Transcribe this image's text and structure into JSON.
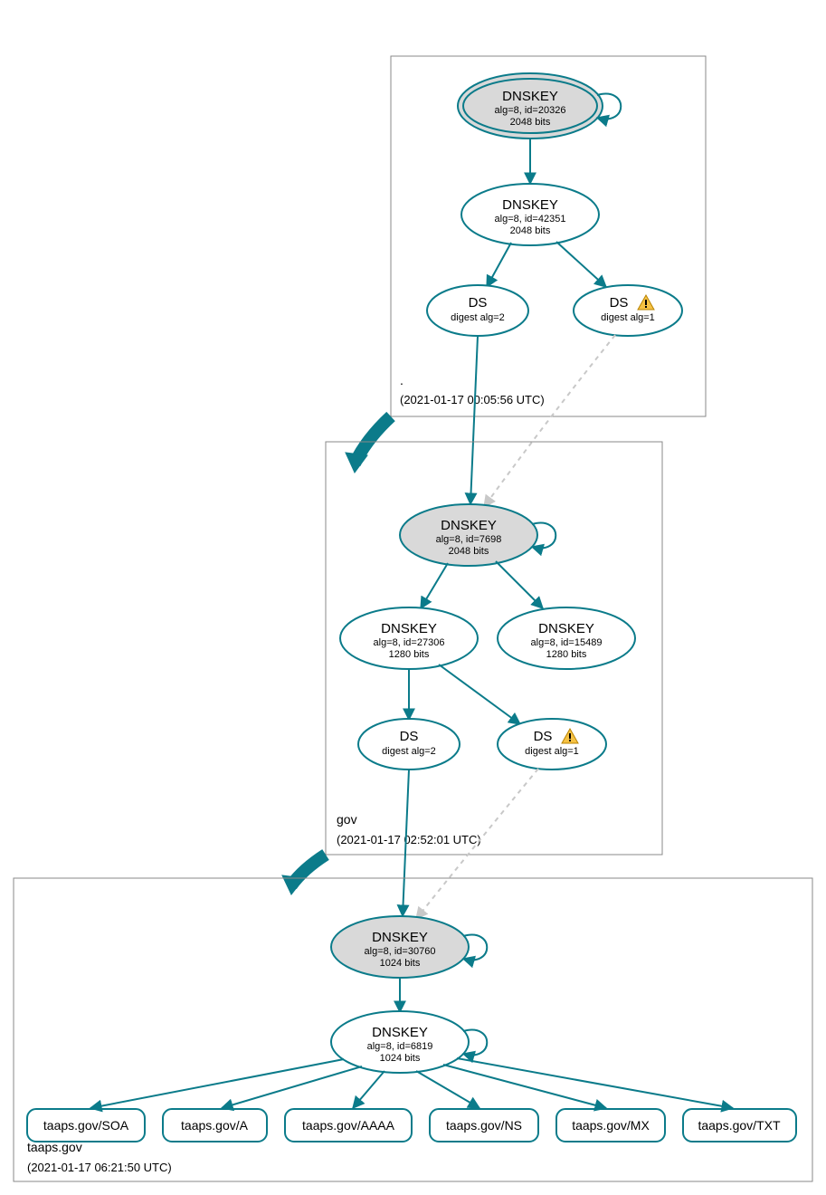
{
  "zones": {
    "root": {
      "name": ".",
      "timestamp": "(2021-01-17 00:05:56 UTC)",
      "nodes": {
        "ksk": {
          "title": "DNSKEY",
          "line2": "alg=8, id=20326",
          "line3": "2048 bits"
        },
        "zsk": {
          "title": "DNSKEY",
          "line2": "alg=8, id=42351",
          "line3": "2048 bits"
        },
        "ds1": {
          "title": "DS",
          "line2": "digest alg=2"
        },
        "ds2": {
          "title": "DS",
          "line2": "digest alg=1",
          "warn": true
        }
      }
    },
    "gov": {
      "name": "gov",
      "timestamp": "(2021-01-17 02:52:01 UTC)",
      "nodes": {
        "ksk": {
          "title": "DNSKEY",
          "line2": "alg=8, id=7698",
          "line3": "2048 bits"
        },
        "zsk1": {
          "title": "DNSKEY",
          "line2": "alg=8, id=27306",
          "line3": "1280 bits"
        },
        "zsk2": {
          "title": "DNSKEY",
          "line2": "alg=8, id=15489",
          "line3": "1280 bits"
        },
        "ds1": {
          "title": "DS",
          "line2": "digest alg=2"
        },
        "ds2": {
          "title": "DS",
          "line2": "digest alg=1",
          "warn": true
        }
      }
    },
    "taaps": {
      "name": "taaps.gov",
      "timestamp": "(2021-01-17 06:21:50 UTC)",
      "nodes": {
        "ksk": {
          "title": "DNSKEY",
          "line2": "alg=8, id=30760",
          "line3": "1024 bits"
        },
        "zsk": {
          "title": "DNSKEY",
          "line2": "alg=8, id=6819",
          "line3": "1024 bits"
        }
      },
      "records": [
        "taaps.gov/SOA",
        "taaps.gov/A",
        "taaps.gov/AAAA",
        "taaps.gov/NS",
        "taaps.gov/MX",
        "taaps.gov/TXT"
      ]
    }
  }
}
